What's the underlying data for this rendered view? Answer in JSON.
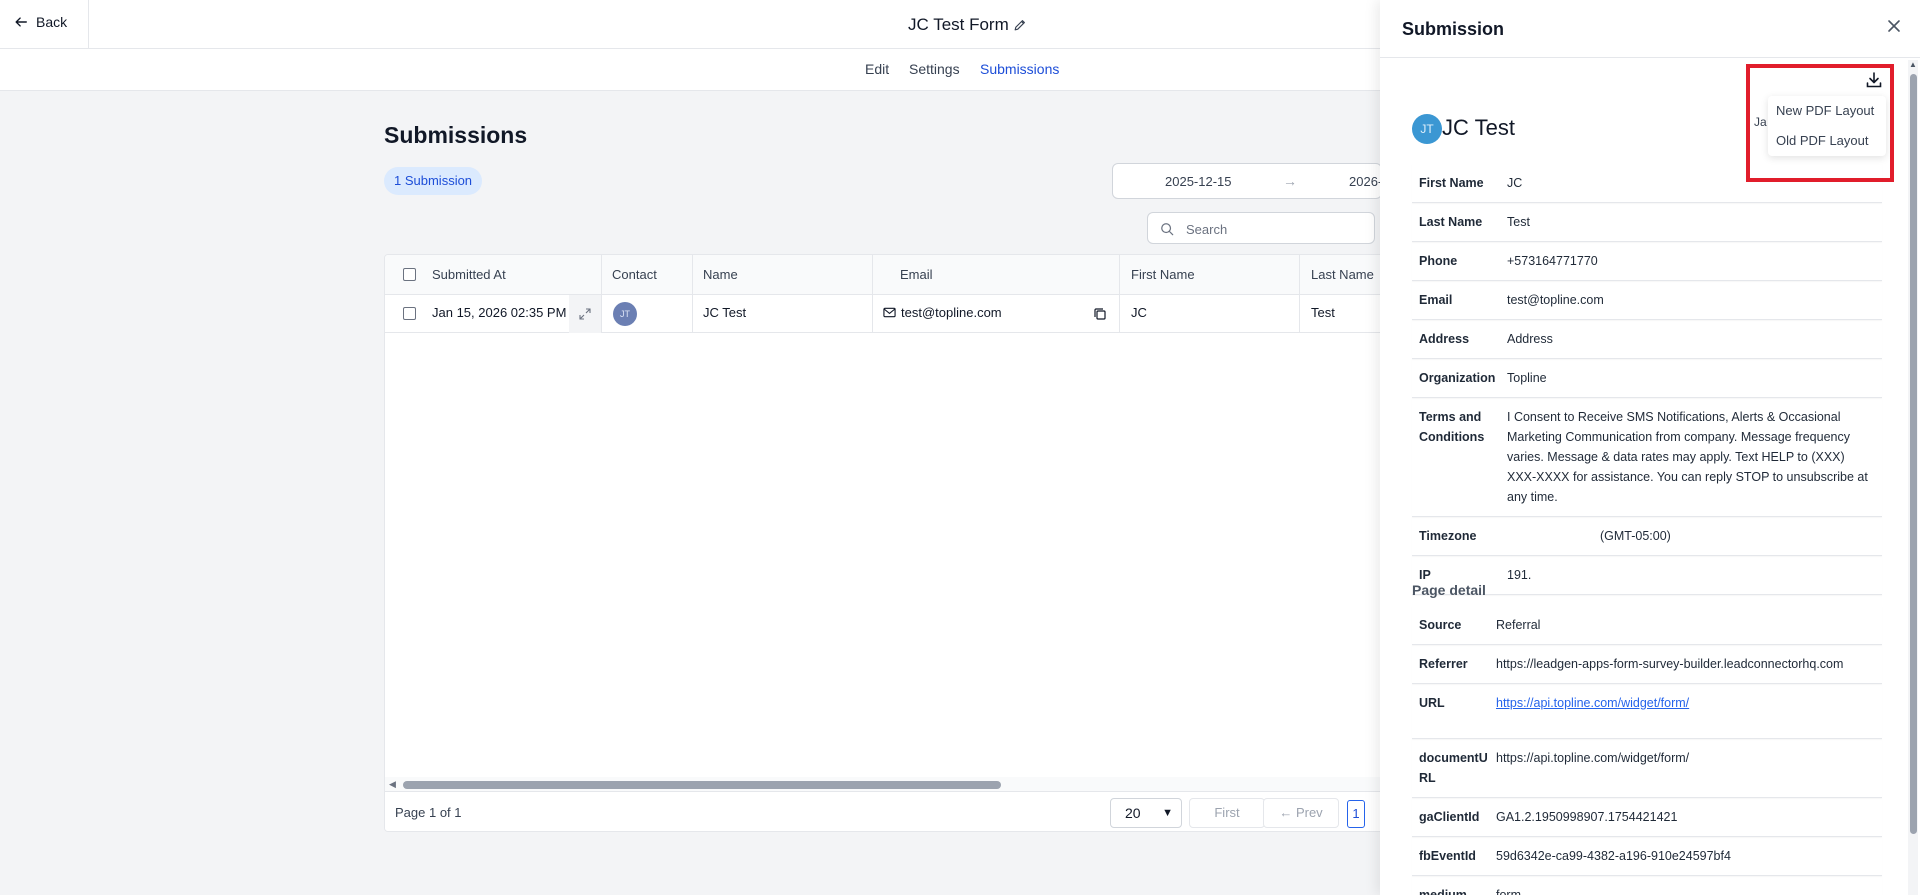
{
  "header": {
    "back_label": "Back",
    "form_title": "JC Test Form"
  },
  "tabs": [
    {
      "label": "Edit"
    },
    {
      "label": "Settings"
    },
    {
      "label": "Submissions",
      "active": true
    }
  ],
  "main": {
    "heading": "Submissions",
    "count_badge": "1 Submission",
    "date_start": "2025-12-15",
    "date_end": "2026-",
    "search_placeholder": "Search"
  },
  "table": {
    "columns": [
      "Submitted At",
      "Contact",
      "Name",
      "Email",
      "First Name",
      "Last Name"
    ],
    "rows": [
      {
        "submitted_at": "Jan 15, 2026 02:35 PM",
        "contact_initials": "JT",
        "name": "JC Test",
        "email": "test@topline.com",
        "first_name": "JC",
        "last_name": "Test"
      }
    ],
    "scroll_position": 0
  },
  "pagination": {
    "page_info": "Page 1 of 1",
    "page_size": "20",
    "first_label": "First",
    "prev_label": "Prev",
    "current_page": "1"
  },
  "drawer": {
    "title": "Submission",
    "avatar_initials": "JT",
    "name": "JC Test",
    "date_partial": "Ja",
    "pdf_menu": [
      "New PDF Layout",
      "Old PDF Layout"
    ],
    "fields": [
      {
        "label": "First Name",
        "value": "JC"
      },
      {
        "label": "Last Name",
        "value": "Test"
      },
      {
        "label": "Phone",
        "value": "+573164771770"
      },
      {
        "label": "Email",
        "value": "test@topline.com"
      },
      {
        "label": "Address",
        "value": "Address"
      },
      {
        "label": "Organization",
        "value": "Topline"
      },
      {
        "label": "Terms and Conditions",
        "value": "I Consent to Receive SMS Notifications, Alerts & Occasional Marketing Communication from company. Message frequency varies. Message & data rates may apply. Text HELP to (XXX) XXX-XXXX for assistance. You can reply STOP to unsubscribe at any time."
      },
      {
        "label": "Timezone",
        "value": "(GMT-05:00)"
      },
      {
        "label": "IP",
        "value": "191."
      }
    ],
    "page_detail_heading": "Page detail",
    "page_details": [
      {
        "label": "Source",
        "value": "Referral"
      },
      {
        "label": "Referrer",
        "value": "https://leadgen-apps-form-survey-builder.leadconnectorhq.com"
      },
      {
        "label": "URL",
        "value": "https://api.topline.com/widget/form/",
        "link": true
      },
      {
        "label": "documentURL",
        "value": "https://api.topline.com/widget/form/"
      },
      {
        "label": "gaClientId",
        "value": "GA1.2.1950998907.1754421421"
      },
      {
        "label": "fbEventId",
        "value": "59d6342e-ca99-4382-a196-910e24597bf4"
      },
      {
        "label": "medium",
        "value": "form"
      }
    ]
  },
  "colors": {
    "accent": "#1d4ed8",
    "highlight": "#e11d2b",
    "avatar": "#3b97d3"
  }
}
